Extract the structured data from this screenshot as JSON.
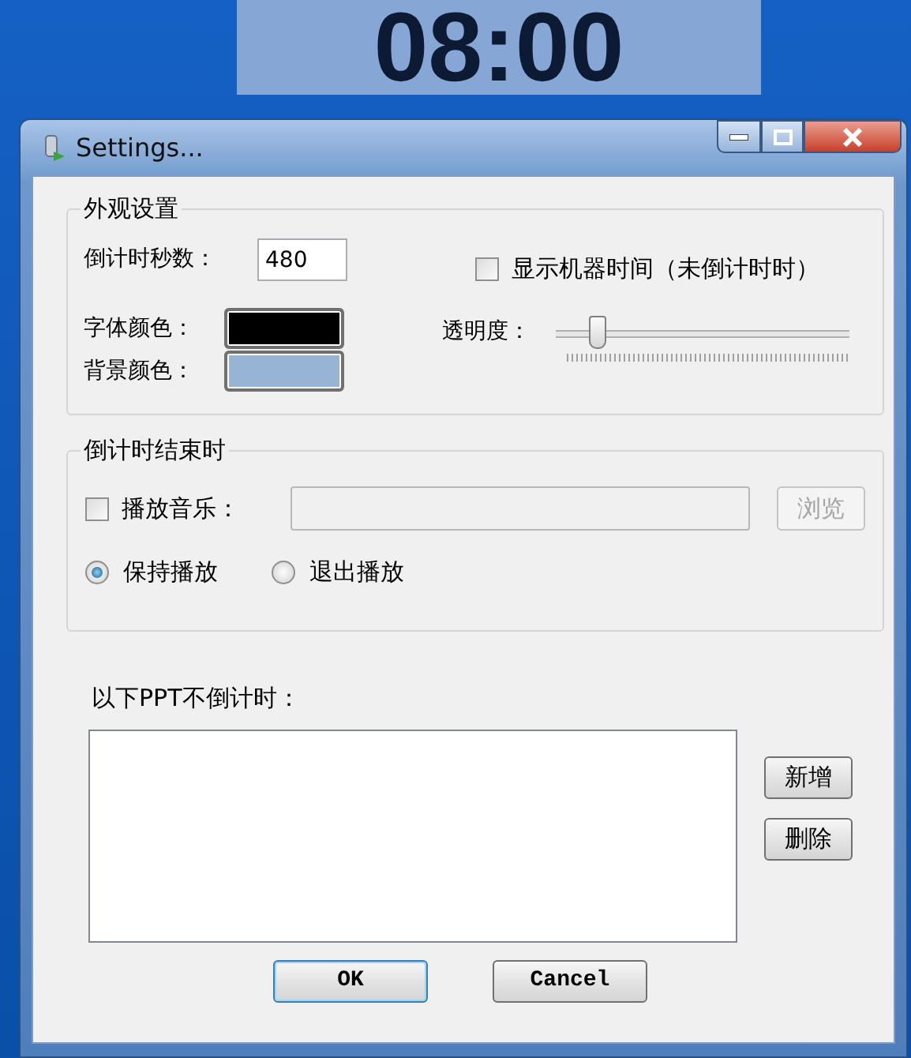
{
  "desktop": {
    "clock": "08:00"
  },
  "window": {
    "title": "Settings..."
  },
  "appearance": {
    "legend": "外观设置",
    "seconds_label": "倒计时秒数：",
    "seconds_value": "480",
    "show_time": {
      "label": "显示机器时间（未倒计时时）",
      "checked": false
    },
    "font_color": {
      "label": "字体颜色：",
      "color": "#000000"
    },
    "bg_color": {
      "label": "背景颜色：",
      "color": "#98b4d4"
    },
    "opacity": {
      "label": "透明度：",
      "level": 0.14
    }
  },
  "on_end": {
    "legend": "倒计时结束时",
    "play_music": {
      "label": "播放音乐：",
      "checked": false
    },
    "music_path": {
      "disabled": true
    },
    "browse": {
      "label": "浏览",
      "disabled": true
    },
    "modes": [
      {
        "label": "保持播放",
        "selected": true
      },
      {
        "label": "退出播放",
        "selected": false
      }
    ]
  },
  "exclusions": {
    "label": "以下PPT不倒计时：",
    "buttons": [
      {
        "label": "新增"
      },
      {
        "label": "删除"
      }
    ]
  },
  "footer": [
    {
      "label": "OK",
      "default": true
    },
    {
      "label": "Cancel",
      "default": false
    }
  ]
}
